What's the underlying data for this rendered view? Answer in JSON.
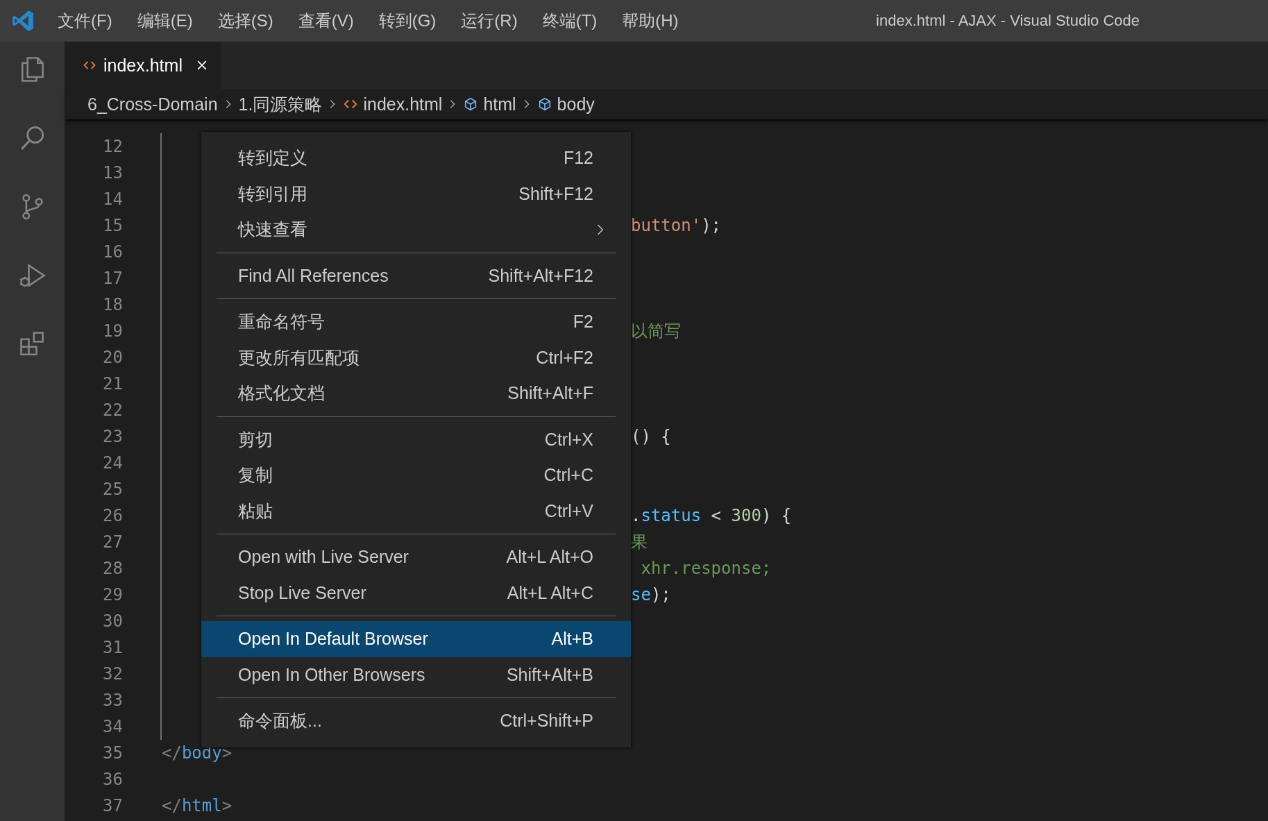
{
  "window": {
    "title": "index.html - AJAX - Visual Studio Code"
  },
  "menu_bar": [
    "文件(F)",
    "编辑(E)",
    "选择(S)",
    "查看(V)",
    "转到(G)",
    "运行(R)",
    "终端(T)",
    "帮助(H)"
  ],
  "activity_bar": [
    {
      "kind": "explorer",
      "selected": false
    },
    {
      "kind": "search",
      "selected": false
    },
    {
      "kind": "source_control",
      "selected": false
    },
    {
      "kind": "run_debug",
      "selected": false
    },
    {
      "kind": "extensions",
      "selected": false
    }
  ],
  "tabs": [
    {
      "label": "index.html",
      "selected": true
    }
  ],
  "breadcrumbs": [
    {
      "kind": "folder",
      "label": "6_Cross-Domain"
    },
    {
      "kind": "folder",
      "label": "1.同源策略"
    },
    {
      "kind": "file",
      "label": "index.html"
    },
    {
      "kind": "symbol",
      "label": "html"
    },
    {
      "kind": "symbol",
      "label": "body"
    }
  ],
  "editor": {
    "lines": [
      {
        "number": "12",
        "kind": "plain",
        "indent_guide": true
      },
      {
        "number": "13",
        "kind": "plain",
        "indent_guide": true
      },
      {
        "number": "14",
        "kind": "plain",
        "indent_guide": true
      },
      {
        "number": "15",
        "kind": "past_menu",
        "indent_guide": true,
        "tokens": [
          {
            "text": "button'",
            "kind": "string"
          },
          {
            "text": ");",
            "kind": "punct"
          }
        ]
      },
      {
        "number": "16",
        "kind": "plain",
        "indent_guide": true
      },
      {
        "number": "17",
        "kind": "plain",
        "indent_guide": true
      },
      {
        "number": "18",
        "kind": "plain",
        "indent_guide": true
      },
      {
        "number": "19",
        "kind": "past_menu",
        "indent_guide": true,
        "tokens": [
          {
            "text": "以简写",
            "kind": "comment"
          }
        ]
      },
      {
        "number": "20",
        "kind": "plain",
        "indent_guide": true
      },
      {
        "number": "21",
        "kind": "plain",
        "indent_guide": true
      },
      {
        "number": "22",
        "kind": "plain",
        "indent_guide": true
      },
      {
        "number": "23",
        "kind": "past_menu",
        "indent_guide": true,
        "tokens": [
          {
            "text": "() {",
            "kind": "punct"
          }
        ]
      },
      {
        "number": "24",
        "kind": "plain",
        "indent_guide": true
      },
      {
        "number": "25",
        "kind": "plain",
        "indent_guide": true
      },
      {
        "number": "26",
        "kind": "past_menu",
        "indent_guide": true,
        "tokens": [
          {
            "text": ".",
            "kind": "punct"
          },
          {
            "text": "status",
            "kind": "property"
          },
          {
            "text": " < ",
            "kind": "punct"
          },
          {
            "text": "300",
            "kind": "number"
          },
          {
            "text": ") {",
            "kind": "punct"
          }
        ]
      },
      {
        "number": "27",
        "kind": "past_menu",
        "indent_guide": true,
        "tokens": [
          {
            "text": "果",
            "kind": "comment"
          }
        ]
      },
      {
        "number": "28",
        "kind": "past_menu",
        "indent_guide": true,
        "tokens": [
          {
            "text": " xhr.response;",
            "kind": "comment"
          }
        ]
      },
      {
        "number": "29",
        "kind": "past_menu",
        "indent_guide": true,
        "tokens": [
          {
            "text": "se",
            "kind": "property"
          },
          {
            "text": ");",
            "kind": "punct"
          }
        ]
      },
      {
        "number": "30",
        "kind": "plain",
        "indent_guide": true
      },
      {
        "number": "31",
        "kind": "plain",
        "indent_guide": true
      },
      {
        "number": "32",
        "kind": "plain",
        "indent_guide": true
      },
      {
        "number": "33",
        "kind": "plain",
        "indent_guide": true
      },
      {
        "number": "34",
        "kind": "plain",
        "indent_guide": true
      },
      {
        "number": "35",
        "kind": "plain",
        "indent_guide": false,
        "tokens": [
          {
            "text": "</",
            "kind": "bracket"
          },
          {
            "text": "body",
            "kind": "tag"
          },
          {
            "text": ">",
            "kind": "bracket"
          }
        ]
      },
      {
        "number": "36",
        "kind": "plain",
        "indent_guide": false
      },
      {
        "number": "37",
        "kind": "plain",
        "indent_guide": false,
        "tokens": [
          {
            "text": "</",
            "kind": "bracket"
          },
          {
            "text": "html",
            "kind": "tag"
          },
          {
            "text": ">",
            "kind": "bracket"
          }
        ]
      }
    ]
  },
  "context_menu": {
    "entries": [
      {
        "kind": "item",
        "label": "转到定义",
        "shortcut": "F12",
        "submenu": false,
        "selected": false
      },
      {
        "kind": "item",
        "label": "转到引用",
        "shortcut": "Shift+F12",
        "submenu": false,
        "selected": false
      },
      {
        "kind": "item",
        "label": "快速查看",
        "submenu": true,
        "selected": false
      },
      {
        "kind": "separator"
      },
      {
        "kind": "item",
        "label": "Find All References",
        "shortcut": "Shift+Alt+F12",
        "submenu": false,
        "selected": false
      },
      {
        "kind": "separator"
      },
      {
        "kind": "item",
        "label": "重命名符号",
        "shortcut": "F2",
        "submenu": false,
        "selected": false
      },
      {
        "kind": "item",
        "label": "更改所有匹配项",
        "shortcut": "Ctrl+F2",
        "submenu": false,
        "selected": false
      },
      {
        "kind": "item",
        "label": "格式化文档",
        "shortcut": "Shift+Alt+F",
        "submenu": false,
        "selected": false
      },
      {
        "kind": "separator"
      },
      {
        "kind": "item",
        "label": "剪切",
        "shortcut": "Ctrl+X",
        "submenu": false,
        "selected": false
      },
      {
        "kind": "item",
        "label": "复制",
        "shortcut": "Ctrl+C",
        "submenu": false,
        "selected": false
      },
      {
        "kind": "item",
        "label": "粘贴",
        "shortcut": "Ctrl+V",
        "submenu": false,
        "selected": false
      },
      {
        "kind": "separator"
      },
      {
        "kind": "item",
        "label": "Open with Live Server",
        "shortcut": "Alt+L Alt+O",
        "submenu": false,
        "selected": false
      },
      {
        "kind": "item",
        "label": "Stop Live Server",
        "shortcut": "Alt+L Alt+C",
        "submenu": false,
        "selected": false
      },
      {
        "kind": "separator"
      },
      {
        "kind": "item",
        "label": "Open In Default Browser",
        "shortcut": "Alt+B",
        "submenu": false,
        "selected": true
      },
      {
        "kind": "item",
        "label": "Open In Other Browsers",
        "shortcut": "Shift+Alt+B",
        "submenu": false,
        "selected": false
      },
      {
        "kind": "separator"
      },
      {
        "kind": "item",
        "label": "命令面板...",
        "shortcut": "Ctrl+Shift+P",
        "submenu": false,
        "selected": false
      }
    ]
  }
}
